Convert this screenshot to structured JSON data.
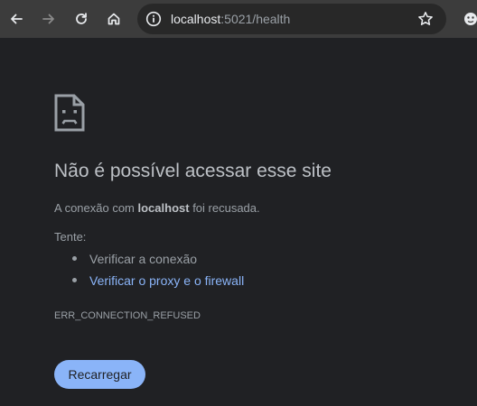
{
  "browser": {
    "url_host": "localhost",
    "url_rest": ":5021/health",
    "icons": [
      "back-icon",
      "forward-icon",
      "reload-icon",
      "home-icon",
      "site-info-icon",
      "star-icon",
      "extension-icon"
    ]
  },
  "error_page": {
    "icon": "sad-file-icon",
    "title": "Não é possível acessar esse site",
    "desc_prefix": "A conexão com ",
    "desc_host": "localhost",
    "desc_suffix": " foi recusada.",
    "try_label": "Tente:",
    "suggestions": [
      "Verificar a conexão",
      "Verificar o proxy e o firewall"
    ],
    "error_code": "ERR_CONNECTION_REFUSED",
    "reload_label": "Recarregar"
  },
  "colors": {
    "page_bg": "#202124",
    "toolbar_bg": "#3c3c3c",
    "omnibox_bg": "#282828",
    "link": "#8ab4f8",
    "button_bg": "#8ab4f8",
    "title_text": "#bdc1c6",
    "body_text": "#9aa0a6"
  }
}
